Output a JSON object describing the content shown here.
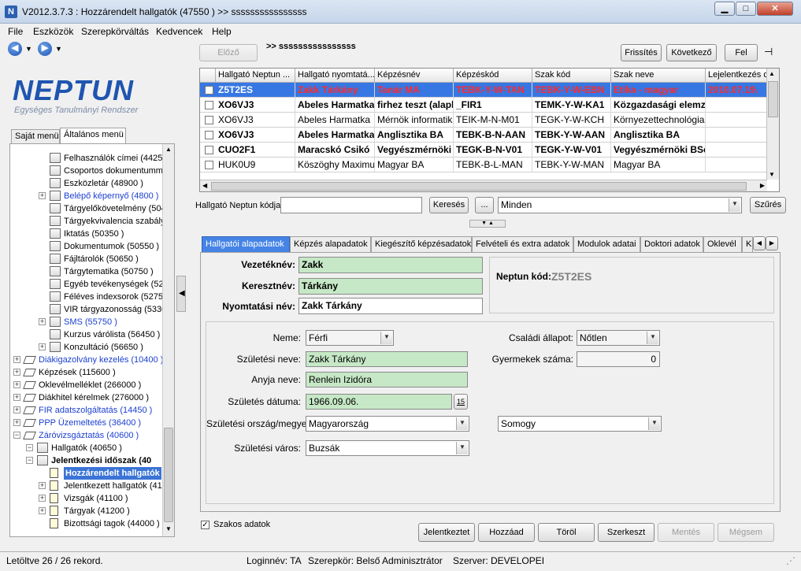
{
  "window": {
    "title": "V2012.3.7.3 : Hozzárendelt hallgatók (47550 )  >> ssssssssssssssss"
  },
  "menu": [
    "File",
    "Eszközök",
    "Szerepkörváltás",
    "Kedvencek",
    "Help"
  ],
  "logo": {
    "name": "NEPTUN",
    "subtitle": "Egységes Tanulmányi Rendszer"
  },
  "left_tabs": [
    "Saját menü",
    "Általános menü"
  ],
  "tree": [
    {
      "label": "Felhasználók címei (44250 )",
      "indent": 2,
      "exp": false,
      "icon": "book",
      "blue": false
    },
    {
      "label": "Csoportos dokumentummegte",
      "indent": 2,
      "exp": false,
      "icon": "book",
      "blue": false
    },
    {
      "label": "Eszközletár (48900 )",
      "indent": 2,
      "exp": false,
      "icon": "book",
      "blue": false
    },
    {
      "label": "Belépő képernyő (4800 )",
      "indent": 2,
      "exp": true,
      "icon": "book",
      "blue": true
    },
    {
      "label": "Tárgyelőkövetelmény (50450",
      "indent": 2,
      "exp": false,
      "icon": "book",
      "blue": false
    },
    {
      "label": "Tárgyekvivalencia szabályok",
      "indent": 2,
      "exp": false,
      "icon": "book",
      "blue": false
    },
    {
      "label": "Iktatás (50350 )",
      "indent": 2,
      "exp": false,
      "icon": "book",
      "blue": false
    },
    {
      "label": "Dokumentumok (50550 )",
      "indent": 2,
      "exp": false,
      "icon": "book",
      "blue": false
    },
    {
      "label": "Fájltárolók (50650 )",
      "indent": 2,
      "exp": false,
      "icon": "book",
      "blue": false
    },
    {
      "label": "Tárgytematika (50750 )",
      "indent": 2,
      "exp": false,
      "icon": "book",
      "blue": false
    },
    {
      "label": "Egyéb tevékenységek (52550",
      "indent": 2,
      "exp": false,
      "icon": "book",
      "blue": false
    },
    {
      "label": "Féléves indexsorok (52750 )",
      "indent": 2,
      "exp": false,
      "icon": "book",
      "blue": false
    },
    {
      "label": "VIR tárgyazonosság (53300 )",
      "indent": 2,
      "exp": false,
      "icon": "book",
      "blue": false
    },
    {
      "label": "SMS (55750 )",
      "indent": 2,
      "exp": true,
      "icon": "book",
      "blue": true
    },
    {
      "label": "Kurzus várólista (56450 )",
      "indent": 2,
      "exp": false,
      "icon": "book",
      "blue": false
    },
    {
      "label": "Konzultáció (56650 )",
      "indent": 2,
      "exp": true,
      "icon": "book",
      "blue": false
    },
    {
      "label": "Diákigazolvány kezelés (10400 )",
      "indent": 0,
      "exp": true,
      "icon": "tag",
      "blue": true
    },
    {
      "label": "Képzések (115600 )",
      "indent": 0,
      "exp": true,
      "icon": "tag",
      "blue": false
    },
    {
      "label": "Oklevélmelléklet (266000 )",
      "indent": 0,
      "exp": true,
      "icon": "tag",
      "blue": false
    },
    {
      "label": "Diákhitel kérelmek (276000 )",
      "indent": 0,
      "exp": true,
      "icon": "tag",
      "blue": false
    },
    {
      "label": "FIR adatszolgáltatás (14450 )",
      "indent": 0,
      "exp": true,
      "icon": "tag",
      "blue": true
    },
    {
      "label": "PPP Üzemeltetés (36400 )",
      "indent": 0,
      "exp": true,
      "icon": "tag",
      "blue": true
    },
    {
      "label": "Záróvizsgáztatás (40600 )",
      "indent": 0,
      "exp": true,
      "icon": "tag",
      "blue": true
    },
    {
      "label": "Hallgatók (40650 )",
      "indent": 1,
      "exp": true,
      "icon": "book",
      "blue": false
    },
    {
      "label": "Jelentkezési időszak (40",
      "indent": 1,
      "exp": true,
      "icon": "book",
      "blue": false,
      "bold": true
    },
    {
      "label": "Hozzárendelt hallgatók",
      "indent": 2,
      "exp": false,
      "icon": "page",
      "blue": false,
      "selected": true
    },
    {
      "label": "Jelentkezett hallgatók (41",
      "indent": 2,
      "exp": true,
      "icon": "page",
      "blue": false
    },
    {
      "label": "Vizsgák (41100 )",
      "indent": 2,
      "exp": true,
      "icon": "page",
      "blue": false
    },
    {
      "label": "Tárgyak (41200 )",
      "indent": 2,
      "exp": true,
      "icon": "page",
      "blue": false
    },
    {
      "label": "Bizottsági tagok (44000 )",
      "indent": 2,
      "exp": false,
      "icon": "page",
      "blue": false
    }
  ],
  "toolbar": {
    "prev": "Előző",
    "breadcrumb": ">> ssssssssssssssss",
    "refresh": "Frissítés",
    "next": "Következő",
    "up": "Fel"
  },
  "grid": {
    "columns": [
      "Hallgató Neptun ...",
      "Hallgató nyomtatá...",
      "Képzésnév",
      "Képzéskód",
      "Szak kód",
      "Szak neve",
      "Lejelentkezés d"
    ],
    "rows": [
      {
        "cells": [
          "Z5T2ES",
          "Zakk Tárkány",
          "Tanár MA",
          "TEBK-Y-W-TAN",
          "TEBK-Y-W-EBN_",
          "Etika - magyar",
          "2010.07.19."
        ],
        "style": "s"
      },
      {
        "cells": [
          "XO6VJ3",
          "Abeles Harmatka",
          "firhez teszt (alapl",
          "_FIR1",
          "TEMK-Y-W-KA1",
          "Közgazdasági elemz",
          ""
        ],
        "style": "b"
      },
      {
        "cells": [
          "XO6VJ3",
          "Abeles Harmatka",
          "Mérnök informatikus",
          "TEIK-M-N-M01",
          "TEGK-Y-W-KCH",
          "Környezettechnológia sz",
          ""
        ],
        "style": ""
      },
      {
        "cells": [
          "XO6VJ3",
          "Abeles Harmatka",
          "Anglisztika BA",
          "TEBK-B-N-AAN",
          "TEBK-Y-W-AAN",
          "Anglisztika BA",
          ""
        ],
        "style": "b"
      },
      {
        "cells": [
          "CUO2F1",
          "Maracskó Csikó",
          "Vegyészmérnöki",
          "TEGK-B-N-V01",
          "TEGK-Y-W-V01",
          "Vegyészmérnöki BSc",
          ""
        ],
        "style": "b"
      },
      {
        "cells": [
          "HUK0U9",
          "Köszöghy Maximusz",
          "Magyar BA",
          "TEBK-B-L-MAN",
          "TEBK-Y-W-MAN",
          "Magyar BA",
          ""
        ],
        "style": ""
      }
    ]
  },
  "search": {
    "label": "Hallgató Neptun kódja",
    "value": "",
    "button": "Keresés",
    "dots": "...",
    "filter": "Minden",
    "filter_button": "Szűrés"
  },
  "detail_tabs": [
    "Hallgatói alapadatok",
    "Képzés alapadatok",
    "Kiegészítő képzésadatok",
    "Felvételi és extra adatok",
    "Modulok adatai",
    "Doktori adatok",
    "Oklevél",
    "K"
  ],
  "form": {
    "vezeteknev_label": "Vezetéknév:",
    "vezeteknev": "Zakk",
    "keresztnev_label": "Keresztnév:",
    "keresztnev": "Tárkány",
    "nyomtatasi_label": "Nyomtatási név:",
    "nyomtatasi": "Zakk Tárkány",
    "neptun_label": "Neptun kód:",
    "neptun": "Z5T2ES",
    "neme_label": "Neme:",
    "neme": "Férfi",
    "csaladi_label": "Családi állapot:",
    "csaladi": "Nőtlen",
    "szuletesi_nev_label": "Születési neve:",
    "szuletesi_nev": "Zakk Tárkány",
    "gyermekek_label": "Gyermekek száma:",
    "gyermekek": "0",
    "anyja_label": "Anyja neve:",
    "anyja": "Renlein Izidóra",
    "datum_label": "Születés dátuma:",
    "datum": "1966.09.06.",
    "calendar": "15",
    "orszag_label": "Születési ország/megye:",
    "orszag": "Magyarország",
    "megye": "Somogy",
    "varos_label": "Születési város:",
    "varos": "Buzsák"
  },
  "bottom": {
    "szakos_label": "Szakos adatok",
    "jelentkeztet": "Jelentkeztet",
    "hozzaad": "Hozzáad",
    "torol": "Töröl",
    "szerkeszt": "Szerkeszt",
    "mentes": "Mentés",
    "megsem": "Mégsem"
  },
  "status": {
    "records": "Letöltve 26 / 26 rekord.",
    "login": "Loginnév: TA",
    "role": "Szerepkör: Belső Adminisztrátor",
    "server": "Szerver: DEVELOPEI"
  }
}
